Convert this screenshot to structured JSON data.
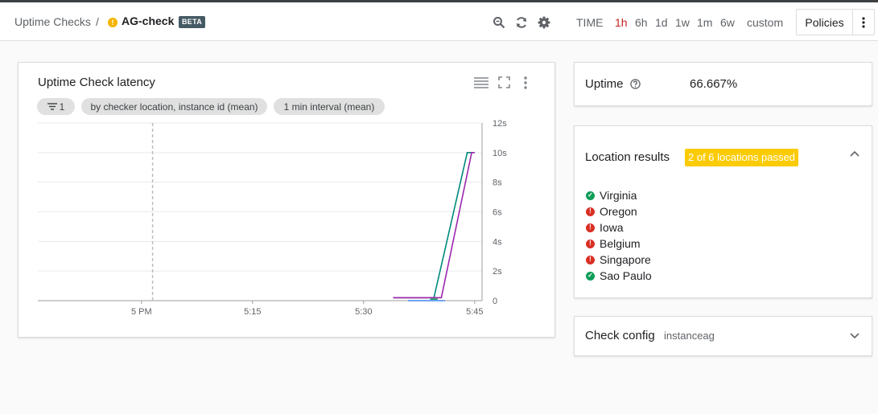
{
  "header": {
    "breadcrumb_root": "Uptime Checks",
    "breadcrumb_sep": "/",
    "check_name": "AG-check",
    "beta_badge": "BETA",
    "warning_glyph": "!",
    "icons": [
      "zoom-icon",
      "refresh-icon",
      "settings-icon"
    ],
    "time_label": "TIME",
    "time_options": [
      {
        "label": "1h",
        "active": true
      },
      {
        "label": "6h",
        "active": false
      },
      {
        "label": "1d",
        "active": false
      },
      {
        "label": "1w",
        "active": false
      },
      {
        "label": "1m",
        "active": false
      },
      {
        "label": "6w",
        "active": false
      },
      {
        "label": "custom",
        "active": false
      }
    ],
    "policies_label": "Policies"
  },
  "chart_card": {
    "title": "Uptime Check latency",
    "filter_count": "1",
    "chip_groupby": "by checker location, instance id (mean)",
    "chip_interval": "1 min interval (mean)"
  },
  "chart_data": {
    "type": "line",
    "title": "Uptime Check latency",
    "xlabel": "",
    "ylabel": "",
    "y_unit": "s",
    "ylim": [
      0,
      12
    ],
    "y_ticks": [
      "0",
      "2s",
      "4s",
      "6s",
      "8s",
      "10s",
      "12s"
    ],
    "x_ticks": [
      "5 PM",
      "5:15",
      "5:30",
      "5:45"
    ],
    "x_tick_minutes": [
      0,
      15,
      30,
      45
    ],
    "xlim_minutes": [
      -14,
      46
    ],
    "now_marker_minutes": 1.5,
    "grid": true,
    "series": [
      {
        "color": "#ff6d00",
        "x": [
          34,
          40.5
        ],
        "y": [
          0.2,
          0.2
        ]
      },
      {
        "color": "#4285f4",
        "x": [
          36,
          41
        ],
        "y": [
          0.0,
          0.0
        ]
      },
      {
        "color": "#0f9d58",
        "x": [
          39,
          40
        ],
        "y": [
          0.1,
          0.1
        ]
      },
      {
        "color": "#00897b",
        "x": [
          34,
          39.5,
          44,
          45
        ],
        "y": [
          0.2,
          0.2,
          10,
          10
        ]
      },
      {
        "color": "#9c27b0",
        "x": [
          34,
          40.5,
          44.6,
          45
        ],
        "y": [
          0.2,
          0.2,
          10,
          10
        ]
      }
    ]
  },
  "uptime": {
    "label": "Uptime",
    "value": "66.667%"
  },
  "locations": {
    "title": "Location results",
    "badge": "2 of 6 locations passed",
    "items": [
      {
        "name": "Virginia",
        "status": "passed"
      },
      {
        "name": "Oregon",
        "status": "failed"
      },
      {
        "name": "Iowa",
        "status": "failed"
      },
      {
        "name": "Belgium",
        "status": "failed"
      },
      {
        "name": "Singapore",
        "status": "failed"
      },
      {
        "name": "Sao Paulo",
        "status": "passed"
      }
    ]
  },
  "check_config": {
    "title": "Check config",
    "value": "instanceag"
  }
}
